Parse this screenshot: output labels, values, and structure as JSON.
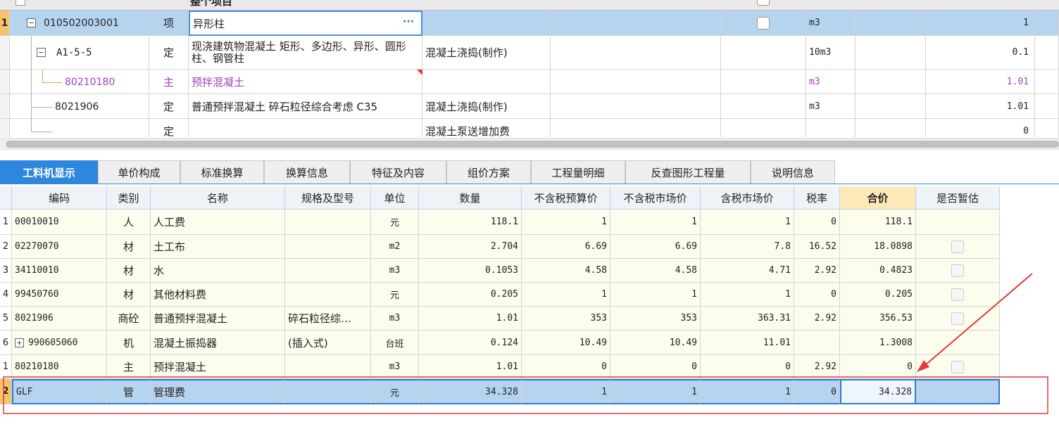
{
  "top_header": {
    "label": "整个项目"
  },
  "top_rows": [
    {
      "num": "1",
      "code": "010502003001",
      "type": "项",
      "name": "异形柱",
      "content": "",
      "unit": "m3",
      "qty": "1"
    },
    {
      "num": "",
      "code": "A1-5-5",
      "type": "定",
      "name": "现浇建筑物混凝土 矩形、多边形、异形、圆形柱、钢管柱",
      "content": "混凝土浇捣(制作)",
      "unit": "10m3",
      "qty": "0.1"
    },
    {
      "num": "",
      "code": "80210180",
      "type": "主",
      "name": "预拌混凝土",
      "content": "",
      "unit": "m3",
      "qty": "1.01"
    },
    {
      "num": "",
      "code": "8021906",
      "type": "定",
      "name": "普通预拌混凝土 碎石粒径综合考虑 C35",
      "content": "混凝土浇捣(制作)",
      "unit": "m3",
      "qty": "1.01"
    },
    {
      "num": "",
      "code": "",
      "type": "定",
      "name": "",
      "content": "混凝土泵送增加费",
      "unit": "",
      "qty": "0"
    }
  ],
  "ellipsis_btn": "···",
  "tabs": [
    "工料机显示",
    "单价构成",
    "标准换算",
    "换算信息",
    "特征及内容",
    "组价方案",
    "工程量明细",
    "反查图形工程量",
    "说明信息"
  ],
  "columns": [
    "编码",
    "类别",
    "名称",
    "规格及型号",
    "单位",
    "数量",
    "不含税预算价",
    "不含税市场价",
    "含税市场价",
    "税率",
    "合价",
    "是否暂估"
  ],
  "rows": [
    {
      "num": "1",
      "code": "00010010",
      "cat": "人",
      "name": "人工费",
      "spec": "",
      "unit": "元",
      "qty": "118.1",
      "p1": "1",
      "p2": "1",
      "p3": "1",
      "tax": "0",
      "total": "118.1",
      "chk": false
    },
    {
      "num": "2",
      "code": "02270070",
      "cat": "材",
      "name": "土工布",
      "spec": "",
      "unit": "m2",
      "qty": "2.704",
      "p1": "6.69",
      "p2": "6.69",
      "p3": "7.8",
      "tax": "16.52",
      "total": "18.0898",
      "chk": true
    },
    {
      "num": "3",
      "code": "34110010",
      "cat": "材",
      "name": "水",
      "spec": "",
      "unit": "m3",
      "qty": "0.1053",
      "p1": "4.58",
      "p2": "4.58",
      "p3": "4.71",
      "tax": "2.92",
      "total": "0.4823",
      "chk": true
    },
    {
      "num": "4",
      "code": "99450760",
      "cat": "材",
      "name": "其他材料费",
      "spec": "",
      "unit": "元",
      "qty": "0.205",
      "p1": "1",
      "p2": "1",
      "p3": "1",
      "tax": "0",
      "total": "0.205",
      "chk": true
    },
    {
      "num": "5",
      "code": "8021906",
      "cat": "商砼",
      "name": "普通预拌混凝土",
      "spec": "碎石粒径综…",
      "unit": "m3",
      "qty": "1.01",
      "p1": "353",
      "p2": "353",
      "p3": "363.31",
      "tax": "2.92",
      "total": "356.53",
      "chk": true
    },
    {
      "num": "6",
      "code": "990605060",
      "cat": "机",
      "name": "混凝土振捣器",
      "spec": "(插入式)",
      "unit": "台班",
      "qty": "0.124",
      "p1": "10.49",
      "p2": "10.49",
      "p3": "11.01",
      "tax": "",
      "total": "1.3008",
      "chk": false,
      "expand": true
    },
    {
      "num": "1",
      "code": "80210180",
      "cat": "主",
      "name": "预拌混凝土",
      "spec": "",
      "unit": "m3",
      "qty": "1.01",
      "p1": "0",
      "p2": "0",
      "p3": "0",
      "tax": "2.92",
      "total": "0",
      "chk": true
    },
    {
      "num": "2",
      "code": "GLF",
      "cat": "管",
      "name": "管理费",
      "spec": "",
      "unit": "元",
      "qty": "34.328",
      "p1": "1",
      "p2": "1",
      "p3": "1",
      "tax": "0",
      "total": "34.328",
      "chk": false,
      "selected": true
    }
  ],
  "colors": {
    "tab_active": "#2f86dd",
    "row_selected": "#b7d4ef",
    "row_yellow": "#fdfdee",
    "annotation": "#e23a3a",
    "purple_text": "#a040c0"
  }
}
